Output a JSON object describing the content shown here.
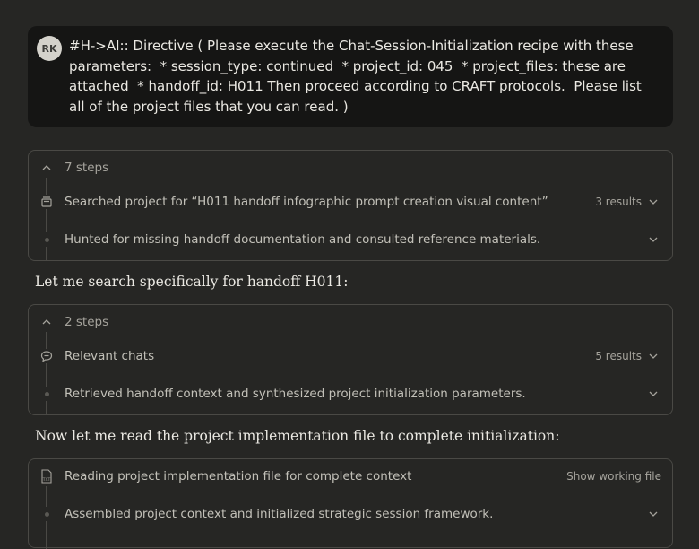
{
  "user_message": {
    "avatar": "RK",
    "text": "#H->AI:: Directive ( Please execute the Chat-Session-Initialization recipe with these\nparameters:  * session_type: continued  * project_id: 045  * project_files: these are\nattached  * handoff_id: H011 Then proceed according to CRAFT protocols.  Please list\nall of the project files that you can read. )"
  },
  "block1": {
    "header": "7 steps",
    "rows": [
      {
        "label": "Searched project for “H011 handoff infographic prompt creation visual content”",
        "meta": "3 results",
        "icon": "folder-search-icon"
      },
      {
        "label": "Hunted for missing handoff documentation and consulted reference materials.",
        "meta": "",
        "icon": "dot"
      }
    ]
  },
  "prose1": "Let me search specifically for handoff H011:",
  "block2": {
    "header": "2 steps",
    "rows": [
      {
        "label": "Relevant chats",
        "meta": "5 results",
        "icon": "chat-bubble-icon"
      },
      {
        "label": "Retrieved handoff context and synthesized project initialization parameters.",
        "meta": "",
        "icon": "dot"
      }
    ]
  },
  "prose2": "Now let me read the project implementation file to complete initialization:",
  "block3": {
    "rows": [
      {
        "label": "Reading project implementation file for complete context",
        "meta": "Show working file",
        "icon": "txt-file-icon"
      },
      {
        "label": "Assembled project context and initialized strategic session framework.",
        "meta": "",
        "icon": "dot"
      }
    ]
  }
}
